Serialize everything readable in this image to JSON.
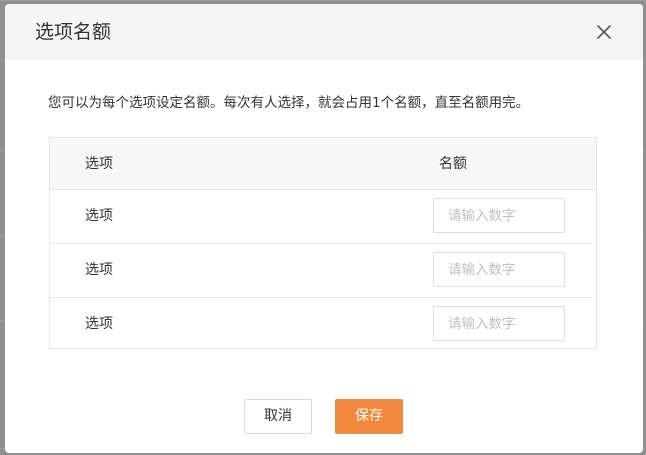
{
  "dialog": {
    "title": "选项名额",
    "description": "您可以为每个选项设定名额。每次有人选择，就会占用1个名额，直至名额用完。"
  },
  "table": {
    "headers": {
      "option": "选项",
      "quota": "名额"
    },
    "rows": [
      {
        "label": "选项",
        "quota_value": "",
        "quota_placeholder": "请输入数字"
      },
      {
        "label": "选项",
        "quota_value": "",
        "quota_placeholder": "请输入数字"
      },
      {
        "label": "选项",
        "quota_value": "",
        "quota_placeholder": "请输入数字"
      }
    ]
  },
  "footer": {
    "cancel_label": "取消",
    "save_label": "保存"
  },
  "colors": {
    "accent": "#f0883e",
    "header_bg": "#f5f5f5",
    "overlay": "#8e8e8e"
  },
  "icons": {
    "close": "close-icon"
  }
}
